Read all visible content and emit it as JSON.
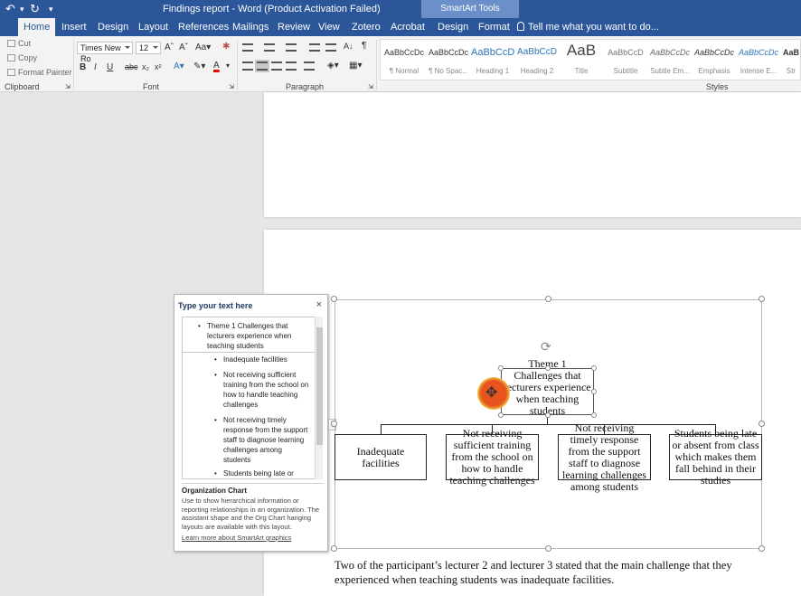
{
  "window": {
    "title": "Findings report - Word (Product Activation Failed)",
    "contextual_tab_group": "SmartArt Tools"
  },
  "tabs": [
    "Home",
    "Insert",
    "Design",
    "Layout",
    "References",
    "Mailings",
    "Review",
    "View",
    "Zotero",
    "Acrobat",
    "Design",
    "Format"
  ],
  "active_tab": "Home",
  "tell_me": "Tell me what you want to do...",
  "clipboard": {
    "cut": "Cut",
    "copy": "Copy",
    "format_painter": "Format Painter",
    "label": "Clipboard"
  },
  "font": {
    "name": "Times New Ro",
    "size": "12",
    "label": "Font"
  },
  "paragraph": {
    "label": "Paragraph"
  },
  "styles": {
    "label": "Styles",
    "items": [
      {
        "sample": "AaBbCcDc",
        "name": "¶ Normal"
      },
      {
        "sample": "AaBbCcDc",
        "name": "¶ No Spac..."
      },
      {
        "sample": "AaBbCcD",
        "name": "Heading 1"
      },
      {
        "sample": "AaBbCcD",
        "name": "Heading 2"
      },
      {
        "sample": "AaB",
        "name": "Title"
      },
      {
        "sample": "AaBbCcD",
        "name": "Subtitle"
      },
      {
        "sample": "AaBbCcDc",
        "name": "Subtle Em..."
      },
      {
        "sample": "AaBbCcDc",
        "name": "Emphasis"
      },
      {
        "sample": "AaBbCcDc",
        "name": "Intense E..."
      },
      {
        "sample": "AaB",
        "name": "Str"
      }
    ]
  },
  "text_pane": {
    "header": "Type your text here",
    "close": "×",
    "items": [
      {
        "level": 1,
        "text": "Theme 1 Challenges that lecturers experience when teaching students"
      },
      {
        "level": 2,
        "text": "Inadequate facilities"
      },
      {
        "level": 2,
        "text": "Not receiving sufficient training from the school on how to handle teaching challenges"
      },
      {
        "level": 2,
        "text": "Not receiving timely response from the support staff to diagnose learning challenges among students"
      },
      {
        "level": 2,
        "text": "Students being late or"
      }
    ],
    "layout_name": "Organization Chart",
    "layout_desc": "Use to show hierarchical information or reporting relationships in an organization. The assistant shape and the Org Chart hanging layouts are available with this layout.",
    "learn_more": "Learn more about SmartArt graphics"
  },
  "smartart": {
    "root": "Theme 1 Challenges that lecturers experience when teaching students",
    "children": [
      "Inadequate facilities",
      "Not receiving sufficient training from the school on how to handle teaching challenges",
      "Not receiving timely response from the support staff to diagnose learning challenges among students",
      "Students being late or absent from class which makes them fall behind in their studies"
    ]
  },
  "body_text": "Two of the participant’s lecturer 2 and lecturer 3 stated that the main challenge that they experienced when teaching students was inadequate facilities."
}
